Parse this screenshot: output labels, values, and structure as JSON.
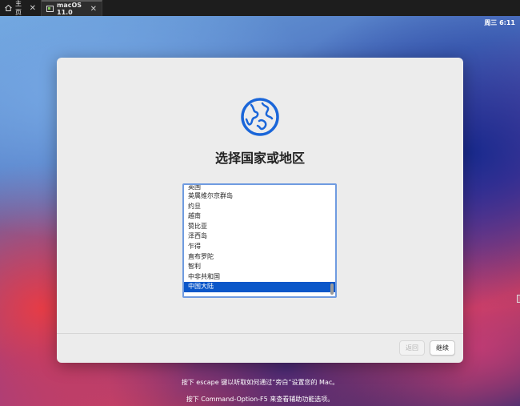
{
  "tabs": [
    {
      "label": "主页",
      "icon": "home-icon"
    },
    {
      "label": "macOS 11.0",
      "icon": "vm-icon"
    }
  ],
  "status_bar": {
    "clock": "周三 6:11"
  },
  "setup": {
    "icon": "globe-icon",
    "title": "选择国家或地区",
    "countries": [
      "英国",
      "英属维尔京群岛",
      "约旦",
      "越南",
      "赞比亚",
      "泽西岛",
      "乍得",
      "直布罗陀",
      "智利",
      "中非共和国",
      "中国大陆"
    ],
    "selected": "中国大陆",
    "back_label": "返回",
    "continue_label": "继续"
  },
  "hints": {
    "line1": "按下 escape 键以听取如何通过“旁白”设置您的 Mac。",
    "line2": "按下 Command-Option-F5 来查看辅助功能选项。"
  },
  "colors": {
    "accent": "#0b57c9",
    "panel": "#ececec"
  }
}
